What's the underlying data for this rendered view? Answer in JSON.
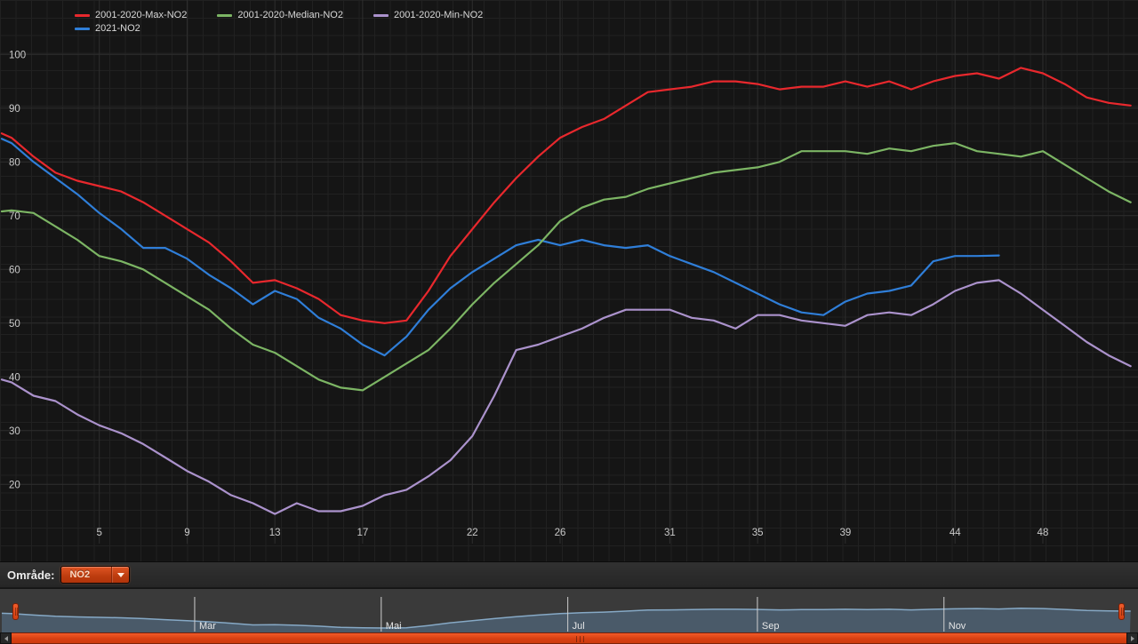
{
  "legend": {
    "row1": [
      {
        "label": "2001-2020-Max-NO2",
        "color": "#e8282d"
      },
      {
        "label": "2001-2020-Median-NO2",
        "color": "#7cb564"
      },
      {
        "label": "2001-2020-Min-NO2",
        "color": "#ab92cc"
      }
    ],
    "row2": [
      {
        "label": "2021-NO2",
        "color": "#2f7ed8"
      }
    ]
  },
  "chart_data": {
    "type": "line",
    "x_unit": "week-of-year",
    "x_tick_weeks": [
      5,
      9,
      13,
      17,
      22,
      26,
      31,
      35,
      39,
      44,
      48
    ],
    "y_ticks": [
      100,
      90,
      80,
      70,
      60,
      50,
      40,
      30,
      20
    ],
    "ylim": [
      13,
      102
    ],
    "grid": true,
    "legend_position": "top-left",
    "series": [
      {
        "name": "2001-2020-Max-NO2",
        "color": "#e8282d",
        "lead": 85.3,
        "values": [
          84.5,
          81,
          78,
          76.5,
          75.5,
          74.5,
          72.5,
          70,
          67.5,
          65,
          61.5,
          57.5,
          58,
          56.5,
          54.5,
          51.5,
          50.5,
          50,
          50.5,
          56,
          62.5,
          67.5,
          72.5,
          77,
          81,
          84.5,
          86.5,
          88,
          90.5,
          93,
          93.5,
          94,
          95,
          95,
          94.5,
          93.5,
          94,
          94,
          95,
          94,
          95,
          93.5,
          95,
          96,
          96.5,
          95.5,
          97.5,
          96.5,
          94.5,
          92,
          91,
          90.5
        ]
      },
      {
        "name": "2021-NO2",
        "color": "#2f7ed8",
        "lead": 84.3,
        "values": [
          83.5,
          80,
          77,
          74,
          70.5,
          67.5,
          64,
          64,
          62,
          59,
          56.5,
          53.5,
          56,
          54.5,
          51,
          49,
          46,
          44,
          47.5,
          52.5,
          56.5,
          59.5,
          62,
          64.5,
          65.5,
          64.5,
          65.5,
          64.5,
          64,
          64.5,
          62.5,
          61,
          59.5,
          57.5,
          55.5,
          53.5,
          52,
          51.5,
          54,
          55.5,
          56,
          57,
          61.5,
          62.5,
          62.5,
          62.6
        ]
      },
      {
        "name": "2001-2020-Median-NO2",
        "color": "#7cb564",
        "lead": 70.8,
        "values": [
          71,
          70.5,
          68,
          65.5,
          62.5,
          61.5,
          60,
          57.5,
          55,
          52.5,
          49,
          46,
          44.5,
          42,
          39.5,
          38,
          37.5,
          40,
          42.5,
          45,
          49,
          53.5,
          57.5,
          61,
          64.5,
          69,
          71.5,
          73,
          73.5,
          75,
          76,
          77,
          78,
          78.5,
          79,
          80,
          82,
          82,
          82,
          81.5,
          82.5,
          82,
          83,
          83.5,
          82,
          81.5,
          81,
          82,
          79.5,
          77,
          74.5,
          72.5
        ]
      },
      {
        "name": "2001-2020-Min-NO2",
        "color": "#ab92cc",
        "lead": 39.5,
        "values": [
          39,
          36.5,
          35.5,
          33,
          31,
          29.5,
          27.5,
          25,
          22.5,
          20.5,
          18,
          16.5,
          14.5,
          16.5,
          15,
          15,
          16,
          18,
          19,
          21.5,
          24.5,
          29,
          36.5,
          45,
          46,
          47.5,
          49,
          51,
          52.5,
          52.5,
          52.5,
          51,
          50.5,
          49,
          51.5,
          51.5,
          50.5,
          50,
          49.5,
          51.5,
          52,
          51.5,
          53.5,
          56,
          57.5,
          58,
          55.5,
          52.5,
          49.5,
          46.5,
          44,
          42
        ]
      }
    ]
  },
  "omrade": {
    "label": "Område:",
    "dropdown_value": "NO2"
  },
  "navigator": {
    "months": [
      {
        "label": "Mar",
        "day": 60
      },
      {
        "label": "Mai",
        "day": 121
      },
      {
        "label": "Jul",
        "day": 182
      },
      {
        "label": "Sep",
        "day": 244
      },
      {
        "label": "Nov",
        "day": 305
      }
    ],
    "line_color": "#86a9c6",
    "fill_color": "rgba(95,130,165,0.45)"
  },
  "colors": {
    "background": "#151515",
    "grid_minor": "#212121",
    "grid_major": "#2e2e2e",
    "axis_text": "#c9c9c9",
    "accent_orange": "#d84012"
  }
}
